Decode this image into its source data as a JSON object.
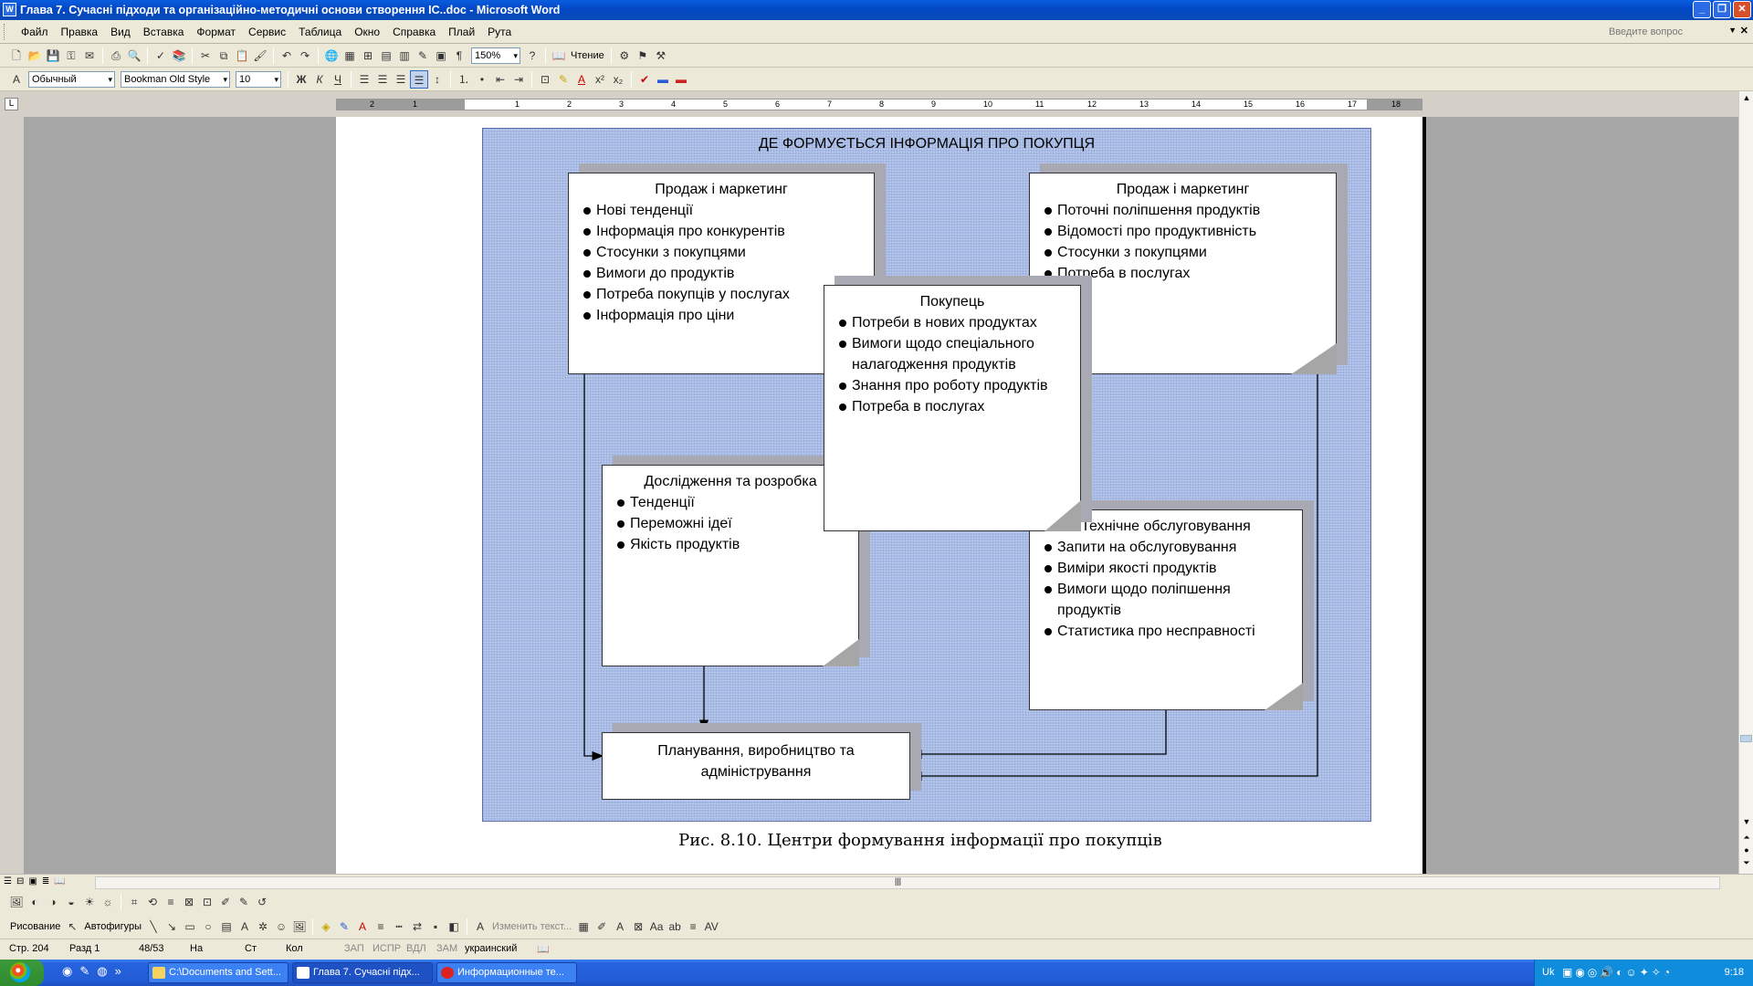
{
  "window": {
    "title": "Глава 7. Сучасні підходи та організаційно-методичні основи створення ІС..doc - Microsoft Word",
    "app_icon": "W"
  },
  "menu": {
    "items": [
      "Файл",
      "Правка",
      "Вид",
      "Вставка",
      "Формат",
      "Сервис",
      "Таблица",
      "Окно",
      "Справка",
      "Плай",
      "Рута"
    ],
    "ask_placeholder": "Введите вопрос"
  },
  "toolbar": {
    "zoom": "150%",
    "reading_label": "Чтение",
    "style": "Обычный",
    "font": "Bookman Old Style",
    "size": "10"
  },
  "ruler": {
    "marks": [
      "2",
      "1",
      "1",
      "2",
      "3",
      "4",
      "5",
      "6",
      "7",
      "8",
      "9",
      "10",
      "11",
      "12",
      "13",
      "14",
      "15",
      "16",
      "17",
      "18"
    ]
  },
  "diagram": {
    "title": "ДЕ ФОРМУЄТЬСЯ ІНФОРМАЦІЯ ПРО ПОКУПЦЯ",
    "box1": {
      "title": "Продаж і маркетинг",
      "items": [
        "Нові тенденції",
        "Інформація про конкурентів",
        "Стосунки з покупцями",
        "Вимоги до продуктів",
        "Потреба покупців у послугах",
        "Інформація про ціни"
      ]
    },
    "box2": {
      "title": "Продаж і маркетинг",
      "items": [
        "Поточні поліпшення продуктів",
        "Відомості про продуктивність",
        "Стосунки з покупцями",
        "Потреба в послугах"
      ]
    },
    "box3": {
      "title": "Покупець",
      "items": [
        "Потреби в нових продуктах",
        "Вимоги щодо спеціального налагодження продуктів",
        "Знання про роботу продуктів",
        "Потреба в послугах"
      ]
    },
    "box4": {
      "title": "Дослідження та розробка",
      "items": [
        "Тенденції",
        "Переможні ідеї",
        "Якість продуктів"
      ]
    },
    "box5": {
      "title": "Технічне обслуговування",
      "items": [
        "Запити на обслуговування",
        "Виміри якості продуктів",
        "Вимоги щодо поліпшення продуктів",
        "Статистика про несправності"
      ]
    },
    "box6": {
      "title": "Планування, виробництво та адміністрування"
    }
  },
  "caption": "Рис. 8.10. Центри формування інформації про покупців",
  "drawing": {
    "draw_label": "Рисование",
    "autoshapes_label": "Автофигуры",
    "edit_text_label": "Изменить текст..."
  },
  "status": {
    "page": "Стр. 204",
    "section": "Разд 1",
    "pages": "48/53",
    "at": "На",
    "line": "Ст",
    "col": "Кол",
    "rec": "ЗАП",
    "trk": "ИСПР",
    "ext": "ВДЛ",
    "ovr": "ЗАМ",
    "lang": "украинский"
  },
  "taskbar": {
    "tasks": [
      "C:\\Documents and Sett...",
      "Глава 7. Сучасні підх...",
      "Информационные те..."
    ],
    "lang": "Uk",
    "clock": "9:18"
  }
}
